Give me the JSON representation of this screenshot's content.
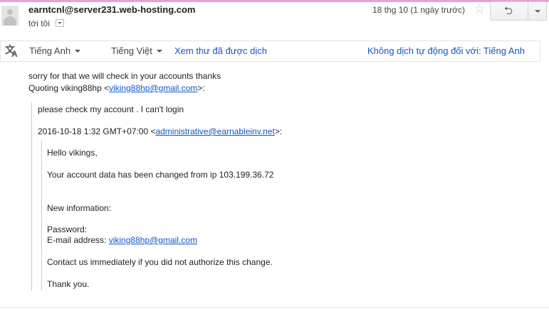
{
  "header": {
    "sender": "earntcnl@server231.web-hosting.com",
    "recipient": "tới tôi",
    "date": "18 thg 10 (1 ngày trước)",
    "star_icon": "star-icon",
    "reply_icon": "reply-icon",
    "more_icon": "chevron-down-icon"
  },
  "translate_bar": {
    "icon": "translate-icon",
    "source_language": "Tiếng Anh",
    "target_language": "Tiếng Việt",
    "view_original": "Xem thư đã được dịch",
    "no_auto_translate": "Không dịch tự động đối với: Tiếng Anh"
  },
  "message": {
    "line1": "sorry for that we will check in your accounts thanks",
    "quoting_prefix": "Quoting viking88hp <",
    "quoting_email": "viking88hp@gmail.com",
    "quoting_suffix": ">:",
    "quote1": {
      "line1": "please check my account . I can't login",
      "attribution_prefix": "2016-10-18 1:32 GMT+07:00 <",
      "attribution_email": "administrative@earnableinv.net",
      "attribution_suffix": ">:"
    },
    "quote2": {
      "greeting": "Hello vikings,",
      "changed": "Your account data has been changed from ip 103.199.36.72",
      "new_info": "New information:",
      "password_label": "Password:",
      "email_label": "E-mail address:",
      "email_value": "viking88hp@gmail.com",
      "contact": "Contact us immediately if you did not authorize this change.",
      "thanks": "Thank you."
    }
  },
  "colors": {
    "link": "#1155cc",
    "text": "#222222",
    "top_stripe": "#e8a0d8"
  }
}
